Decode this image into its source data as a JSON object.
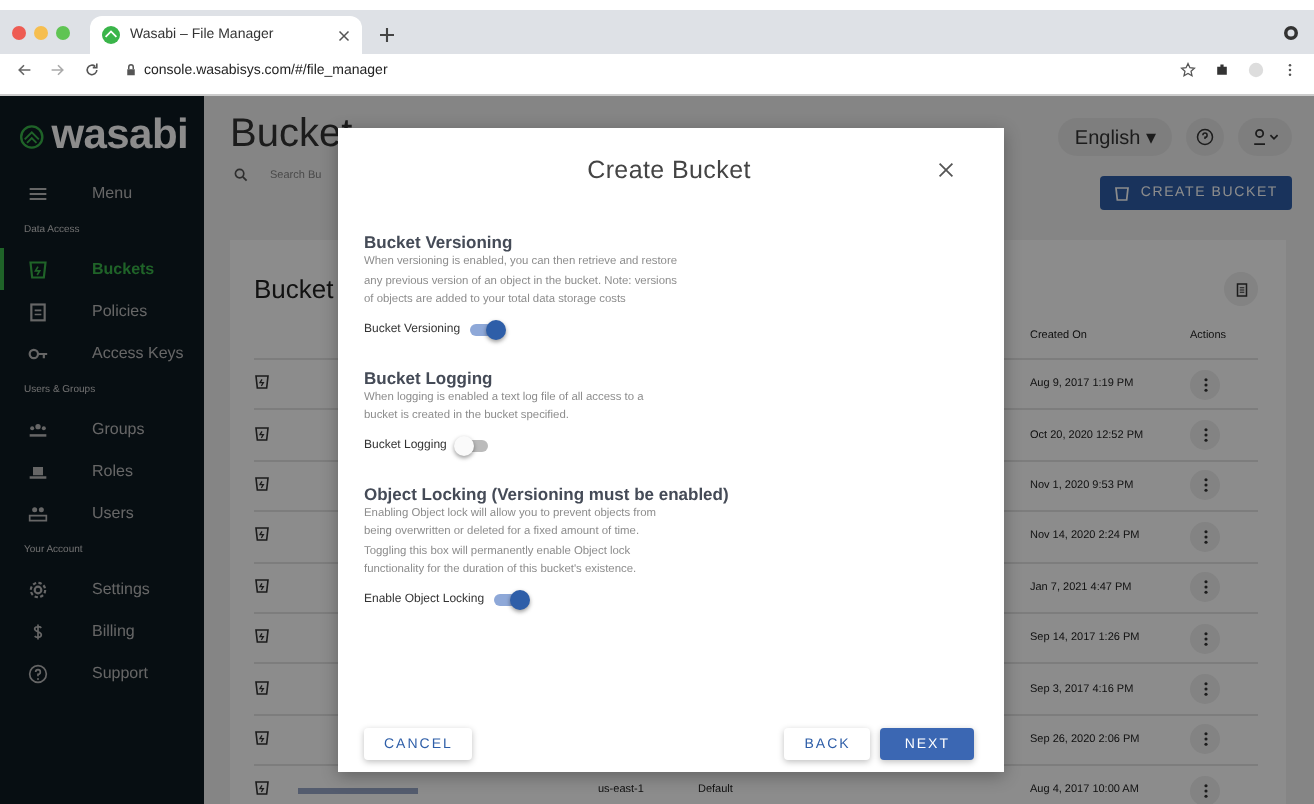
{
  "browser": {
    "tab_title": "Wasabi – File Manager",
    "url": "console.wasabisys.com/#/file_manager"
  },
  "sidebar": {
    "logo": "wasabi",
    "items": [
      {
        "kind": "item",
        "label": "Menu",
        "selected": false
      },
      {
        "kind": "section",
        "label": "Data Access"
      },
      {
        "kind": "item",
        "label": "Buckets",
        "selected": true
      },
      {
        "kind": "item",
        "label": "Policies",
        "selected": false
      },
      {
        "kind": "item",
        "label": "Access Keys",
        "selected": false
      },
      {
        "kind": "section",
        "label": "Users & Groups"
      },
      {
        "kind": "item",
        "label": "Groups",
        "selected": false
      },
      {
        "kind": "item",
        "label": "Roles",
        "selected": false
      },
      {
        "kind": "item",
        "label": "Users",
        "selected": false
      },
      {
        "kind": "section",
        "label": "Your Account"
      },
      {
        "kind": "item",
        "label": "Settings",
        "selected": false
      },
      {
        "kind": "item",
        "label": "Billing",
        "selected": false
      },
      {
        "kind": "item",
        "label": "Support",
        "selected": false
      }
    ]
  },
  "header": {
    "title": "Bucket",
    "search_placeholder": "Search Bu",
    "language": "English ▾",
    "create_button": "CREATE BUCKET"
  },
  "card": {
    "title": "Bucket",
    "columns": [
      "Created On",
      "Actions"
    ],
    "rows": [
      {
        "created_on": "Aug 9, 2017 1:19 PM"
      },
      {
        "created_on": "Oct 20, 2020 12:52 PM"
      },
      {
        "created_on": "Nov 1, 2020 9:53 PM"
      },
      {
        "created_on": "Nov 14, 2020 2:24 PM"
      },
      {
        "created_on": "Jan 7, 2021 4:47 PM"
      },
      {
        "created_on": "Sep 14, 2017 1:26 PM"
      },
      {
        "created_on": "Sep 3, 2017 4:16 PM"
      },
      {
        "created_on": "Sep 26, 2020 2:06 PM"
      },
      {
        "region": "us-east-1",
        "policy": "Default",
        "created_on": "Aug 4, 2017 10:00 AM"
      }
    ]
  },
  "dialog": {
    "title": "Create Bucket",
    "sections": [
      {
        "heading": "Bucket Versioning",
        "text": "When versioning is enabled, you can then retrieve and restore any previous version of an object in the bucket. Note: versions of objects are added to your total data storage costs",
        "toggle_label": "Bucket Versioning",
        "on": true
      },
      {
        "heading": "Bucket Logging",
        "text": "When logging is enabled a text log file of all access to a bucket is created in the bucket specified.",
        "toggle_label": "Bucket Logging",
        "on": false
      },
      {
        "heading": "Object Locking (Versioning must be enabled)",
        "text": "Enabling Object lock will allow you to prevent objects from being overwritten or deleted for a fixed amount of time. Toggling this box will permanently enable Object lock functionality for the duration of this bucket's existence.",
        "toggle_label": "Enable Object Locking",
        "on": true
      }
    ],
    "buttons": {
      "cancel": "CANCEL",
      "back": "BACK",
      "next": "NEXT"
    }
  }
}
